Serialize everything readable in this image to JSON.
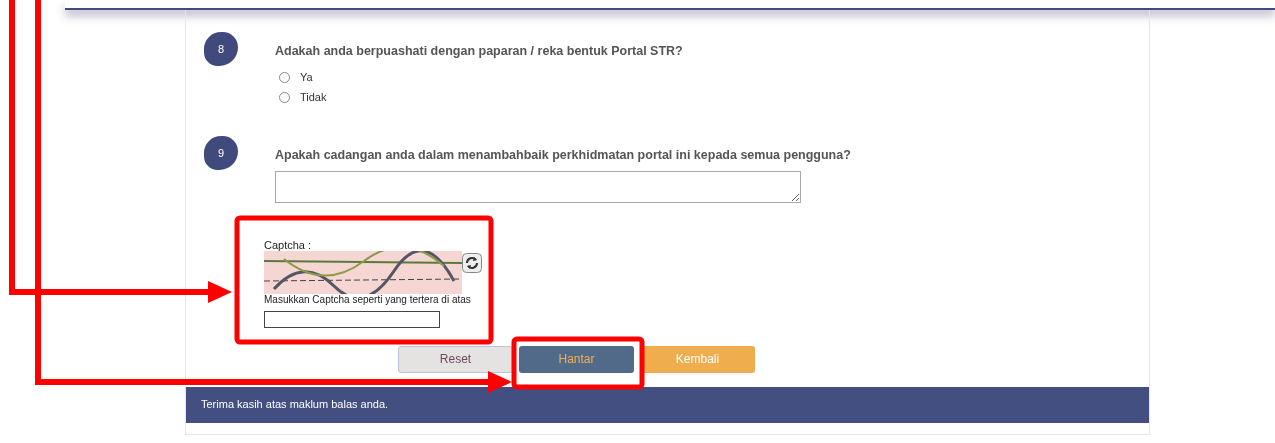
{
  "questions": [
    {
      "number": "8",
      "text": "Adakah anda berpuashati dengan paparan / reka bentuk Portal STR?",
      "kind": "radio",
      "options": [
        {
          "label": "Ya",
          "selected": false
        },
        {
          "label": "Tidak",
          "selected": false
        }
      ]
    },
    {
      "number": "9",
      "text": "Apakah cadangan anda dalam menambahbaik perkhidmatan portal ini kepada semua pengguna?",
      "kind": "textarea"
    }
  ],
  "captcha": {
    "label": "Captcha :",
    "hint": "Masukkan Captcha seperti yang tertera di atas"
  },
  "buttons": [
    {
      "label": "Reset",
      "kind": "reset"
    },
    {
      "label": "Hantar",
      "kind": "submit"
    },
    {
      "label": "Kembali",
      "kind": "back"
    }
  ],
  "footer": "Terima kasih atas maklum balas anda."
}
